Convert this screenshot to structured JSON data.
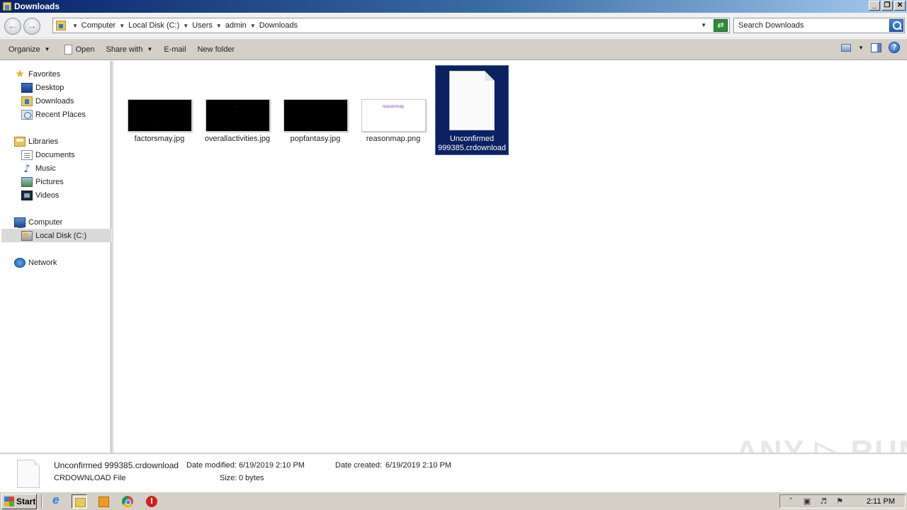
{
  "window": {
    "title": "Downloads",
    "minimize": "_",
    "maximize": "❐",
    "close": "✕"
  },
  "address": {
    "breadcrumbs": [
      "Computer",
      "Local Disk (C:)",
      "Users",
      "admin",
      "Downloads"
    ],
    "search_placeholder": "Search Downloads"
  },
  "toolbar": {
    "organize": "Organize",
    "open": "Open",
    "share_with": "Share with",
    "email": "E-mail",
    "new_folder": "New folder"
  },
  "nav": {
    "favorites": "Favorites",
    "desktop": "Desktop",
    "downloads": "Downloads",
    "recent_places": "Recent Places",
    "libraries": "Libraries",
    "documents": "Documents",
    "music": "Music",
    "pictures": "Pictures",
    "videos": "Videos",
    "computer": "Computer",
    "local_disk": "Local Disk (C:)",
    "network": "Network"
  },
  "files": [
    {
      "name": "factorsmay.jpg",
      "thumb": "dark"
    },
    {
      "name": "overallactivities.jpg",
      "thumb": "dark"
    },
    {
      "name": "popfantasy.jpg",
      "thumb": "dark"
    },
    {
      "name": "reasonmap.png",
      "thumb": "light",
      "thumb_text": "reasonmap"
    },
    {
      "name": "Unconfirmed 999385.crdownload",
      "thumb": "file-icon",
      "selected": true
    }
  ],
  "details": {
    "filename": "Unconfirmed 999385.crdownload",
    "filetype": "CRDOWNLOAD File",
    "date_modified_label": "Date modified:",
    "date_modified": "6/19/2019 2:10 PM",
    "date_created_label": "Date created:",
    "date_created": "6/19/2019 2:10 PM",
    "size_label": "Size:",
    "size": "0 bytes"
  },
  "taskbar": {
    "start": "Start",
    "clock": "2:11 PM"
  },
  "watermark": "ANY ▷ RUN",
  "icons": [
    "search-icon",
    "help-icon",
    "folder-icon",
    "star-icon",
    "computer-icon",
    "network-icon",
    "chrome-icon",
    "ie-icon",
    "stop-icon"
  ]
}
